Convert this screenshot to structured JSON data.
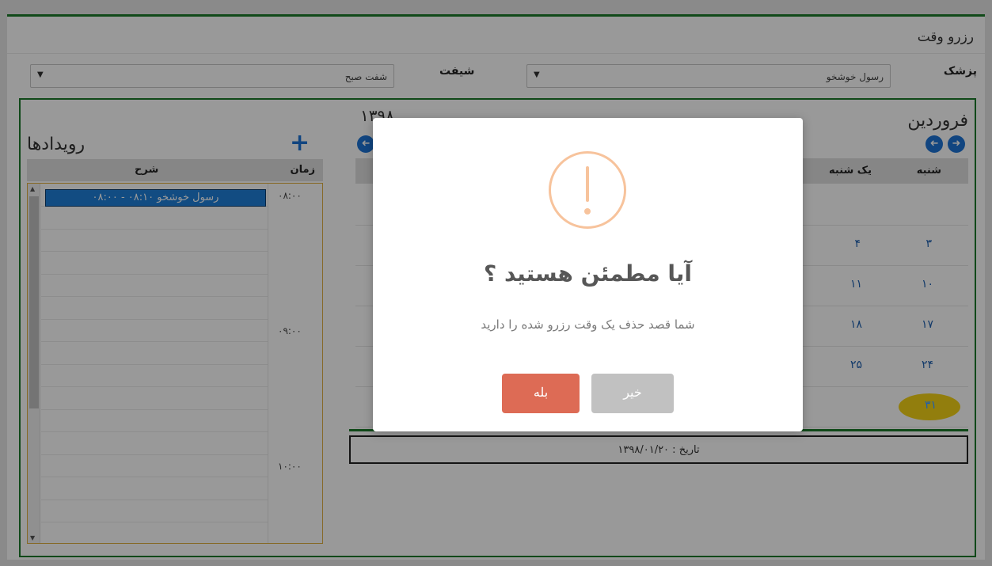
{
  "page": {
    "title": "رزرو وقت"
  },
  "filters": {
    "doctor_label": "پزشک",
    "doctor_value": "رسول خوشخو",
    "shift_label": "شیفت",
    "shift_value": "شفت صبح"
  },
  "calendar": {
    "month": "فروردین",
    "year": "۱۳۹۸",
    "weekdays": [
      "شنبه",
      "یک شنبه"
    ],
    "rows": [
      [
        "",
        ""
      ],
      [
        "۳",
        "۴"
      ],
      [
        "۱۰",
        "۱۱"
      ],
      [
        "۱۷",
        "۱۸"
      ],
      [
        "۲۴",
        "۲۵"
      ],
      [
        "۳۱",
        ""
      ]
    ],
    "highlighted_day": "۳۱",
    "highlight_color": "#f3d216",
    "date_label": "تاریخ : ۱۳۹۸/۰۱/۲۰"
  },
  "events": {
    "title": "رویدادها",
    "columns": {
      "time": "زمان",
      "desc": "شرح"
    },
    "times": [
      "۰۸:۰۰",
      "۰۹:۰۰",
      "۱۰:۰۰"
    ],
    "items": [
      {
        "label": "رسول خوشخو ۰۸:۱۰ - ۰۸:۰۰"
      }
    ]
  },
  "dialog": {
    "title": "آیا مطمئن هستید ؟",
    "message": "شما قصد حذف یک وقت رزرو شده را دارید",
    "confirm_label": "بله",
    "cancel_label": "خیر",
    "confirm_color": "#dd6b55",
    "cancel_color": "#c1c1c1",
    "icon": "warning-icon"
  },
  "colors": {
    "accent": "#1b7a2a",
    "primary": "#1d74d6"
  }
}
